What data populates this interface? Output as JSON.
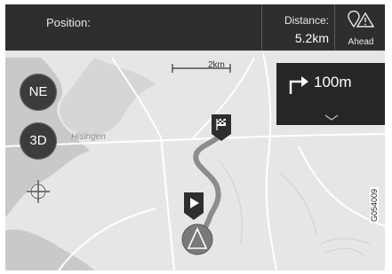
{
  "topbar": {
    "position_label": "Position:",
    "distance_label": "Distance:",
    "distance_value": "5.2km",
    "ahead_label": "Ahead",
    "ahead_icon": "pin-warning-icon"
  },
  "controls": {
    "compass_label": "NE",
    "view_label": "3D",
    "locate_icon": "crosshair-icon"
  },
  "guidance": {
    "turn_icon": "turn-right-arrow-icon",
    "turn_distance": "100m",
    "expand_icon": "chevron-down-icon"
  },
  "map": {
    "scale_label": "2km",
    "place_label": "Hisingen"
  },
  "figure_code": "G054009"
}
